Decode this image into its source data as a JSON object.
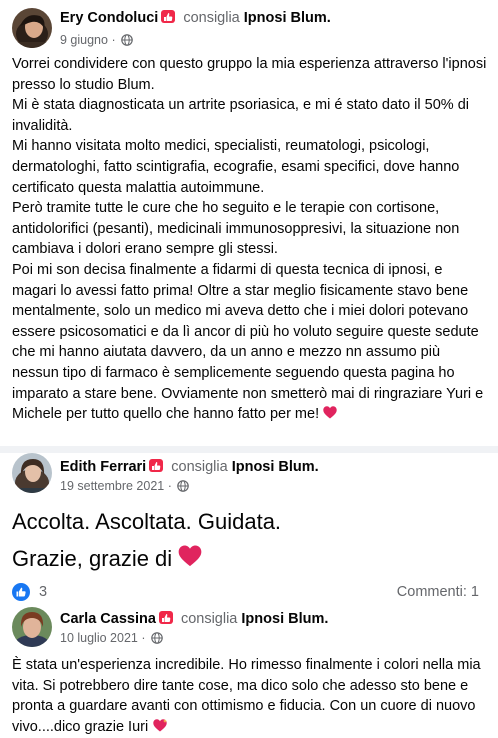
{
  "posts": [
    {
      "author": "Ery Condoluci",
      "action": "consiglia",
      "page": "Ipnosi Blum.",
      "date": "9 giugno",
      "separator": "·",
      "paragraphs": [
        "Vorrei condividere con questo gruppo la mia esperienza attraverso l'ipnosi presso lo studio Blum.",
        "Mi è stata diagnosticata un artrite psoriasica, e mi é stato dato il 50% di invalidità.",
        "Mi hanno visitata molto medici, specialisti, reumatologi, psicologi, dermatologhi, fatto scintigrafia, ecografie, esami specifici, dove hanno certificato questa malattia autoimmune.",
        "Però tramite tutte le cure che ho seguito e le terapie con cortisone, antidolorifici (pesanti), medicinali immunosoppresivi, la situazione non cambiava i dolori erano sempre gli stessi.",
        "Poi mi son decisa finalmente a fidarmi di questa tecnica di ipnosi, e magari lo avessi fatto prima! Oltre a star meglio fisicamente stavo bene mentalmente, solo un medico mi aveva detto che i miei dolori potevano essere psicosomatici e da lì ancor di più ho voluto seguire queste sedute che mi hanno aiutata davvero, da un anno e mezzo nn assumo più nessun tipo di farmaco è semplicemente seguendo questa pagina ho imparato a stare bene. Ovviamente non smetterò mai di ringraziare Yuri e Michele per tutto quello che hanno fatto per me!"
      ]
    },
    {
      "author": "Edith Ferrari",
      "action": "consiglia",
      "page": "Ipnosi Blum.",
      "date": "19 settembre 2021",
      "separator": "·",
      "line1": "Accolta. Ascoltata. Guidata.",
      "line2": "Grazie, grazie di",
      "reactions_count": "3",
      "comments_label": "Commenti: 1"
    },
    {
      "author": "Carla Cassina",
      "action": "consiglia",
      "page": "Ipnosi Blum.",
      "date": "10 luglio 2021",
      "separator": "·",
      "text": "È stata un'esperienza incredibile. Ho rimesso finalmente i colori nella mia vita. Si potrebbero dire tante cose, ma dico solo che adesso sto bene e pronta a guardare avanti con ottimismo e fiducia. Con un cuore di nuovo vivo....dico grazie Iuri"
    }
  ],
  "colors": {
    "heart": "#e0245e",
    "like": "#1877f2",
    "badge": "#f02849",
    "muted": "#65676b"
  },
  "icons": [
    "recommend-badge-icon",
    "globe-icon",
    "heart-emoji-icon",
    "sparkling-heart-emoji-icon",
    "like-icon"
  ]
}
